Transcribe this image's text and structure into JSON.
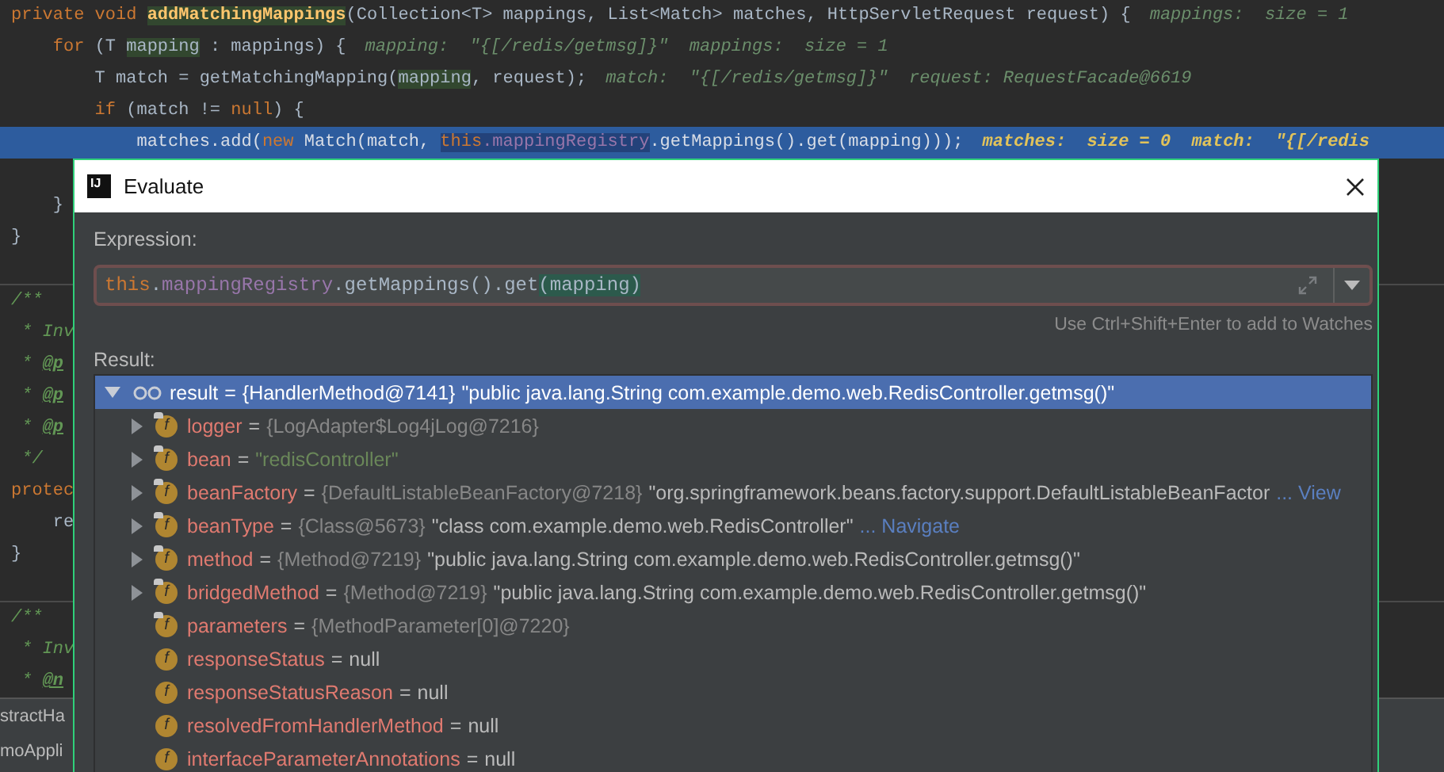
{
  "editor": {
    "lines": [
      {
        "kind": "code",
        "current": false,
        "segments": [
          {
            "text": "private void ",
            "kind": "keyword",
            "highlight": false
          },
          {
            "text": "addMatchingMappings",
            "kind": "method",
            "highlight": true
          },
          {
            "text": "(Collection<T> mappings, List<Match> matches, HttpServletRequest request) {",
            "kind": "plain",
            "highlight": false
          },
          {
            "text": "mappings:  size = 1",
            "kind": "hint",
            "highlight": false
          }
        ]
      },
      {
        "kind": "code",
        "current": false,
        "segments": [
          {
            "text": "    for",
            "kind": "keyword",
            "highlight": false
          },
          {
            "text": " (T ",
            "kind": "plain",
            "highlight": false
          },
          {
            "text": "mapping",
            "kind": "plain",
            "highlight": true
          },
          {
            "text": " : mappings) {",
            "kind": "plain",
            "highlight": false
          },
          {
            "text": "mapping:  \"{[/redis/getmsg]}\"  mappings:  size = 1",
            "kind": "hint",
            "highlight": false
          }
        ]
      },
      {
        "kind": "code",
        "current": false,
        "segments": [
          {
            "text": "        T match = getMatchingMapping(",
            "kind": "plain",
            "highlight": false
          },
          {
            "text": "mapping",
            "kind": "plain",
            "highlight": true
          },
          {
            "text": ", request);",
            "kind": "plain",
            "highlight": false
          },
          {
            "text": "match:  \"{[/redis/getmsg]}\"  request: RequestFacade@6619",
            "kind": "hint",
            "highlight": false
          }
        ]
      },
      {
        "kind": "code",
        "current": false,
        "segments": [
          {
            "text": "        if",
            "kind": "keyword",
            "highlight": false
          },
          {
            "text": " (match != ",
            "kind": "plain",
            "highlight": false
          },
          {
            "text": "null",
            "kind": "keyword",
            "highlight": false
          },
          {
            "text": ") {",
            "kind": "plain",
            "highlight": false
          }
        ]
      },
      {
        "kind": "code",
        "current": true,
        "segments": [
          {
            "text": "            matches.add(",
            "kind": "plain",
            "highlight": false
          },
          {
            "text": "new",
            "kind": "keyword",
            "highlight": false
          },
          {
            "text": " Match(match, ",
            "kind": "plain",
            "highlight": false
          },
          {
            "text": "this",
            "kind": "keyword",
            "highlight": true
          },
          {
            "text": ".mappingRegistry",
            "kind": "field",
            "highlight": true
          },
          {
            "text": ".getMappings().get(mapping)));",
            "kind": "plain",
            "highlight": false
          },
          {
            "text": "matches:  size = 0  match:  \"{[/redis",
            "kind": "hint",
            "highlight": false
          }
        ]
      },
      {
        "kind": "gap"
      },
      {
        "kind": "code",
        "current": false,
        "segments": [
          {
            "text": "    }",
            "kind": "plain",
            "highlight": false
          }
        ]
      },
      {
        "kind": "code",
        "current": false,
        "segments": [
          {
            "text": "}",
            "kind": "plain",
            "highlight": false
          }
        ]
      },
      {
        "kind": "divider"
      },
      {
        "kind": "code",
        "current": false,
        "segments": [
          {
            "text": "/**",
            "kind": "doc",
            "highlight": false
          }
        ]
      },
      {
        "kind": "code",
        "current": false,
        "segments": [
          {
            "text": " * Inv",
            "kind": "doc",
            "highlight": false
          }
        ]
      },
      {
        "kind": "code",
        "current": false,
        "segments": [
          {
            "text": " * ",
            "kind": "doc",
            "highlight": false
          },
          {
            "text": "@p",
            "kind": "doctag",
            "highlight": false
          }
        ]
      },
      {
        "kind": "code",
        "current": false,
        "segments": [
          {
            "text": " * ",
            "kind": "doc",
            "highlight": false
          },
          {
            "text": "@p",
            "kind": "doctag",
            "highlight": false
          }
        ]
      },
      {
        "kind": "code",
        "current": false,
        "segments": [
          {
            "text": " * ",
            "kind": "doc",
            "highlight": false
          },
          {
            "text": "@p",
            "kind": "doctag",
            "highlight": false
          }
        ]
      },
      {
        "kind": "code",
        "current": false,
        "segments": [
          {
            "text": " */",
            "kind": "doc",
            "highlight": false
          }
        ]
      },
      {
        "kind": "code",
        "current": false,
        "segments": [
          {
            "text": "protec",
            "kind": "keyword",
            "highlight": false
          }
        ]
      },
      {
        "kind": "code",
        "current": false,
        "segments": [
          {
            "text": "    re",
            "kind": "plain",
            "highlight": false
          }
        ]
      },
      {
        "kind": "code",
        "current": false,
        "segments": [
          {
            "text": "}",
            "kind": "plain",
            "highlight": false
          }
        ]
      },
      {
        "kind": "divider"
      },
      {
        "kind": "code",
        "current": false,
        "segments": [
          {
            "text": "/**",
            "kind": "doc",
            "highlight": false
          }
        ]
      },
      {
        "kind": "code",
        "current": false,
        "segments": [
          {
            "text": " * Inv",
            "kind": "doc",
            "highlight": false
          }
        ]
      },
      {
        "kind": "code",
        "current": false,
        "segments": [
          {
            "text": " * ",
            "kind": "doc",
            "highlight": false
          },
          {
            "text": "@n",
            "kind": "doctag",
            "highlight": false
          }
        ]
      }
    ]
  },
  "bottom_panel": {
    "items": [
      "stractHa",
      "moAppli"
    ]
  },
  "dialog": {
    "app_icon_text": "IJ",
    "title": "Evaluate",
    "expression_label": "Expression:",
    "expression": [
      {
        "text": "this",
        "kind": "keyword",
        "highlight": false
      },
      {
        "text": ".",
        "kind": "plain",
        "highlight": false
      },
      {
        "text": "mappingRegistry",
        "kind": "field",
        "highlight": false
      },
      {
        "text": ".getMappings().get",
        "kind": "plain",
        "highlight": false
      },
      {
        "text": "(mapping)",
        "kind": "plain",
        "highlight": true
      }
    ],
    "hint": "Use Ctrl+Shift+Enter to add to Watches",
    "result_label": "Result:",
    "result": {
      "selected": true,
      "expanded": true,
      "segments": [
        {
          "text": "result"
        },
        {
          "text": "="
        },
        {
          "text": "{HandlerMethod@7141}"
        },
        {
          "text": "\"public java.lang.String com.example.demo.web.RedisController.getmsg()\""
        }
      ],
      "children": [
        {
          "selected": false,
          "has_children": true,
          "final": true,
          "icon_letter": "f",
          "segments": [
            {
              "text": "logger",
              "kind": "name"
            },
            {
              "text": "=",
              "kind": "value"
            },
            {
              "text": "{LogAdapter$Log4jLog@7216}",
              "kind": "type"
            }
          ]
        },
        {
          "selected": false,
          "has_children": true,
          "final": true,
          "icon_letter": "f",
          "segments": [
            {
              "text": "bean",
              "kind": "name"
            },
            {
              "text": "=",
              "kind": "value"
            },
            {
              "text": "\"redisController\"",
              "kind": "string"
            }
          ]
        },
        {
          "selected": false,
          "has_children": true,
          "final": true,
          "icon_letter": "f",
          "segments": [
            {
              "text": "beanFactory",
              "kind": "name"
            },
            {
              "text": "=",
              "kind": "value"
            },
            {
              "text": "{DefaultListableBeanFactory@7218}",
              "kind": "type"
            },
            {
              "text": "\"org.springframework.beans.factory.support.DefaultListableBeanFactor",
              "kind": "value"
            },
            {
              "text": "... View",
              "kind": "link"
            }
          ]
        },
        {
          "selected": false,
          "has_children": true,
          "final": true,
          "icon_letter": "f",
          "segments": [
            {
              "text": "beanType",
              "kind": "name"
            },
            {
              "text": "=",
              "kind": "value"
            },
            {
              "text": "{Class@5673}",
              "kind": "type"
            },
            {
              "text": "\"class com.example.demo.web.RedisController\"",
              "kind": "value"
            },
            {
              "text": "... Navigate",
              "kind": "link"
            }
          ]
        },
        {
          "selected": false,
          "has_children": true,
          "final": true,
          "icon_letter": "f",
          "segments": [
            {
              "text": "method",
              "kind": "name"
            },
            {
              "text": "=",
              "kind": "value"
            },
            {
              "text": "{Method@7219}",
              "kind": "type"
            },
            {
              "text": "\"public java.lang.String com.example.demo.web.RedisController.getmsg()\"",
              "kind": "value"
            }
          ]
        },
        {
          "selected": false,
          "has_children": true,
          "final": true,
          "icon_letter": "f",
          "segments": [
            {
              "text": "bridgedMethod",
              "kind": "name"
            },
            {
              "text": "=",
              "kind": "value"
            },
            {
              "text": "{Method@7219}",
              "kind": "type"
            },
            {
              "text": "\"public java.lang.String com.example.demo.web.RedisController.getmsg()\"",
              "kind": "value"
            }
          ]
        },
        {
          "selected": false,
          "has_children": false,
          "final": true,
          "icon_letter": "f",
          "segments": [
            {
              "text": "parameters",
              "kind": "name"
            },
            {
              "text": "=",
              "kind": "value"
            },
            {
              "text": "{MethodParameter[0]@7220}",
              "kind": "type"
            }
          ]
        },
        {
          "selected": false,
          "has_children": false,
          "final": false,
          "icon_letter": "f",
          "segments": [
            {
              "text": "responseStatus",
              "kind": "name"
            },
            {
              "text": "=",
              "kind": "value"
            },
            {
              "text": "null",
              "kind": "value"
            }
          ]
        },
        {
          "selected": false,
          "has_children": false,
          "final": false,
          "icon_letter": "f",
          "segments": [
            {
              "text": "responseStatusReason",
              "kind": "name"
            },
            {
              "text": "=",
              "kind": "value"
            },
            {
              "text": "null",
              "kind": "value"
            }
          ]
        },
        {
          "selected": false,
          "has_children": false,
          "final": false,
          "icon_letter": "f",
          "segments": [
            {
              "text": "resolvedFromHandlerMethod",
              "kind": "name"
            },
            {
              "text": "=",
              "kind": "value"
            },
            {
              "text": "null",
              "kind": "value"
            }
          ]
        },
        {
          "selected": false,
          "has_children": false,
          "final": false,
          "icon_letter": "f",
          "segments": [
            {
              "text": "interfaceParameterAnnotations",
              "kind": "name"
            },
            {
              "text": "=",
              "kind": "value"
            },
            {
              "text": "null",
              "kind": "value"
            }
          ]
        }
      ]
    }
  }
}
